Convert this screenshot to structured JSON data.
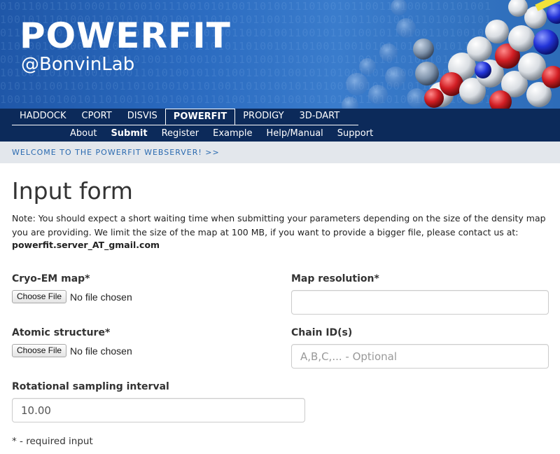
{
  "banner": {
    "title": "POWERFIT",
    "subtitle": "@BonvinLab",
    "image": "molecule-spheres-graphic"
  },
  "nav": {
    "top_items": [
      {
        "label": "HADDOCK",
        "active": false
      },
      {
        "label": "CPORT",
        "active": false
      },
      {
        "label": "DISVIS",
        "active": false
      },
      {
        "label": "POWERFIT",
        "active": true
      },
      {
        "label": "PRODIGY",
        "active": false
      },
      {
        "label": "3D-DART",
        "active": false
      }
    ],
    "sub_items": [
      {
        "label": "About",
        "active": false
      },
      {
        "label": "Submit",
        "active": true
      },
      {
        "label": "Register",
        "active": false
      },
      {
        "label": "Example",
        "active": false
      },
      {
        "label": "Help/Manual",
        "active": false
      },
      {
        "label": "Support",
        "active": false
      }
    ]
  },
  "welcome": {
    "text": "WELCOME TO THE POWERFIT WEBSERVER! >>"
  },
  "main": {
    "title": "Input form",
    "note": "Note: You should expect a short waiting time when submitting your parameters depending on the size of the density map you are providing. We limit the size of the map at 100 MB, if you want to provide a bigger file, please contact us at:",
    "email": "powerfit.server_AT_gmail.com"
  },
  "form": {
    "cryo_em_map": {
      "label": "Cryo-EM map*",
      "button": "Choose File",
      "status": "No file chosen"
    },
    "map_resolution": {
      "label": "Map resolution*",
      "value": "",
      "placeholder": ""
    },
    "atomic_structure": {
      "label": "Atomic structure*",
      "button": "Choose File",
      "status": "No file chosen"
    },
    "chain_ids": {
      "label": "Chain ID(s)",
      "value": "",
      "placeholder": "A,B,C,... - Optional"
    },
    "rotational_sampling": {
      "label": "Rotational sampling interval",
      "value": "10.00"
    },
    "required_note": "* - required input"
  },
  "colors": {
    "banner_blue": "#2b6bc0",
    "nav_dark": "#0c2a5a",
    "welcome_bg": "#e3e7ec",
    "link_blue": "#2a6ab0"
  }
}
